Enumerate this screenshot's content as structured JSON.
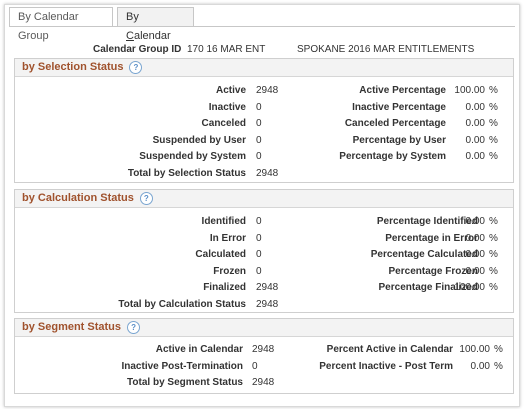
{
  "tabs": [
    {
      "label": "By Calendar Group",
      "active": true
    },
    {
      "label_prefix": "By ",
      "label_underlined": "C",
      "label_rest": "alendar",
      "active": false
    }
  ],
  "header": {
    "label": "Calendar Group ID",
    "id": "170 16 MAR ENT",
    "description": "SPOKANE 2016 MAR ENTITLEMENTS"
  },
  "selection": {
    "title": "by Selection Status",
    "left": [
      {
        "label": "Active",
        "value": "2948"
      },
      {
        "label": "Inactive",
        "value": "0"
      },
      {
        "label": "Canceled",
        "value": "0"
      },
      {
        "label": "Suspended by User",
        "value": "0"
      },
      {
        "label": "Suspended by System",
        "value": "0"
      },
      {
        "label": "Total by Selection Status",
        "value": "2948"
      }
    ],
    "right": [
      {
        "label": "Active Percentage",
        "value": "100.00",
        "unit": "%"
      },
      {
        "label": "Inactive Percentage",
        "value": "0.00",
        "unit": "%"
      },
      {
        "label": "Canceled Percentage",
        "value": "0.00",
        "unit": "%"
      },
      {
        "label": "Percentage by User",
        "value": "0.00",
        "unit": "%"
      },
      {
        "label": "Percentage by System",
        "value": "0.00",
        "unit": "%"
      }
    ]
  },
  "calculation": {
    "title": "by Calculation Status",
    "left": [
      {
        "label": "Identified",
        "value": "0"
      },
      {
        "label": "In Error",
        "value": "0"
      },
      {
        "label": "Calculated",
        "value": "0"
      },
      {
        "label": "Frozen",
        "value": "0"
      },
      {
        "label": "Finalized",
        "value": "2948"
      },
      {
        "label": "Total by Calculation Status",
        "value": "2948"
      }
    ],
    "right": [
      {
        "label": "Percentage Identified",
        "value": "0.00",
        "unit": "%"
      },
      {
        "label": "Percentage in Error",
        "value": "0.00",
        "unit": "%"
      },
      {
        "label": "Percentage Calculated",
        "value": "0.00",
        "unit": "%"
      },
      {
        "label": "Percentage Frozen",
        "value": "0.00",
        "unit": "%"
      },
      {
        "label": "Percentage Finalized",
        "value": "100.00",
        "unit": "%"
      }
    ]
  },
  "segment": {
    "title": "by Segment Status",
    "left": [
      {
        "label": "Active in Calendar",
        "value": "2948"
      },
      {
        "label": "Inactive Post-Termination",
        "value": "0"
      },
      {
        "label": "Total by Segment Status",
        "value": "2948"
      }
    ],
    "right": [
      {
        "label": "Percent Active in Calendar",
        "value": "100.00",
        "unit": "%"
      },
      {
        "label": "Percent Inactive - Post Term",
        "value": "0.00",
        "unit": "%"
      }
    ]
  },
  "help_icon_glyph": "?"
}
